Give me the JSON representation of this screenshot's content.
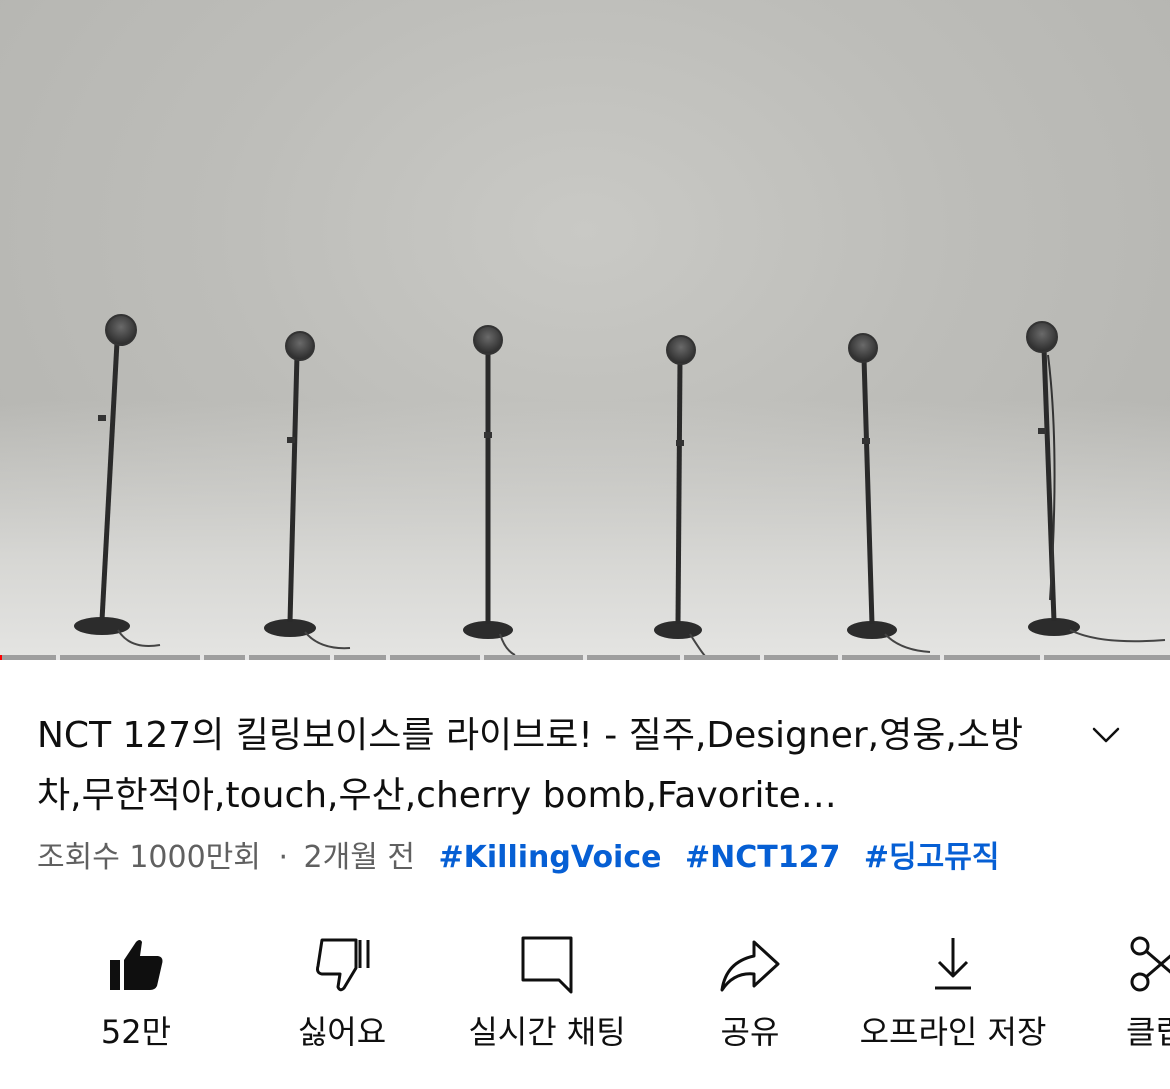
{
  "video": {
    "progress_fraction": 0.002
  },
  "title": "NCT 127의 킬링보이스를 라이브로! - 질주,Designer,영웅,소방차,무한적아,touch,우산,cherry bomb,Favorite…",
  "meta": {
    "views": "조회수 1000만회",
    "separator": "·",
    "age": "2개월 전",
    "tags": [
      "#KillingVoice",
      "#NCT127",
      "#딩고뮤직"
    ]
  },
  "actions": {
    "like": {
      "label": "52만",
      "icon": "thumb-up-filled-icon"
    },
    "dislike": {
      "label": "싫어요",
      "icon": "thumb-down-icon"
    },
    "live_chat": {
      "label": "실시간 채팅",
      "icon": "chat-icon"
    },
    "share": {
      "label": "공유",
      "icon": "share-arrow-icon"
    },
    "download": {
      "label": "오프라인 저장",
      "icon": "download-icon"
    },
    "clip": {
      "label": "클립",
      "icon": "scissors-icon"
    }
  },
  "colors": {
    "hashtag": "#065fd4",
    "progress_played": "#ff0000",
    "muted_text": "#606060"
  }
}
